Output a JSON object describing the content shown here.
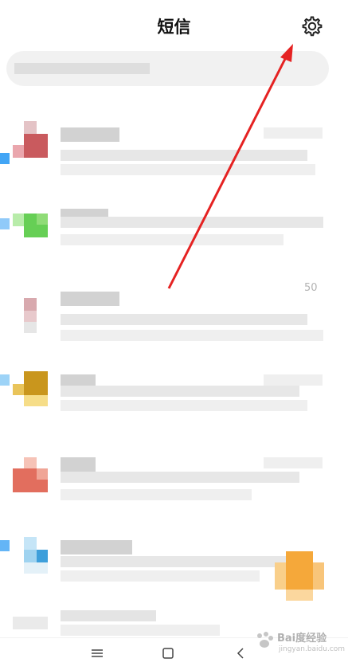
{
  "header": {
    "title": "短信",
    "settings_icon": "gear-icon"
  },
  "search": {
    "placeholder": ""
  },
  "conversations": [
    {
      "avatar_colors": [
        "#d9a6ab",
        "#c95a5e",
        "#eaa6ad"
      ],
      "edge_color": "#42a5f5"
    },
    {
      "avatar_colors": [
        "#8fdc77",
        "#66cf55",
        "#b8ecaa"
      ],
      "edge_color": "#90caf9"
    },
    {
      "avatar_colors": [
        "#e8c9cc",
        "#d8a9ae",
        "#e6e6e6"
      ],
      "edge_color": "",
      "badge_text": "50"
    },
    {
      "avatar_colors": [
        "#e9c45a",
        "#c9961d",
        "#f6dd88"
      ],
      "edge_color": "#9dd3f7"
    },
    {
      "avatar_colors": [
        "#f0a596",
        "#e26e5e",
        "#f6c3b7"
      ],
      "edge_color": ""
    },
    {
      "avatar_colors": [
        "#9fd3f0",
        "#3d9fdb",
        "#c5e5f7"
      ],
      "edge_color": "#64b5f6"
    }
  ],
  "fab": {
    "color": "#f5a83a",
    "icon": "compose-icon"
  },
  "navbar": {
    "menu_icon": "menu-icon",
    "home_icon": "home-icon",
    "back_icon": "back-icon"
  },
  "annotation": {
    "color": "#e52222"
  },
  "watermark": {
    "text": "Bai度经验",
    "sub": "jingyan.baidu.com"
  }
}
